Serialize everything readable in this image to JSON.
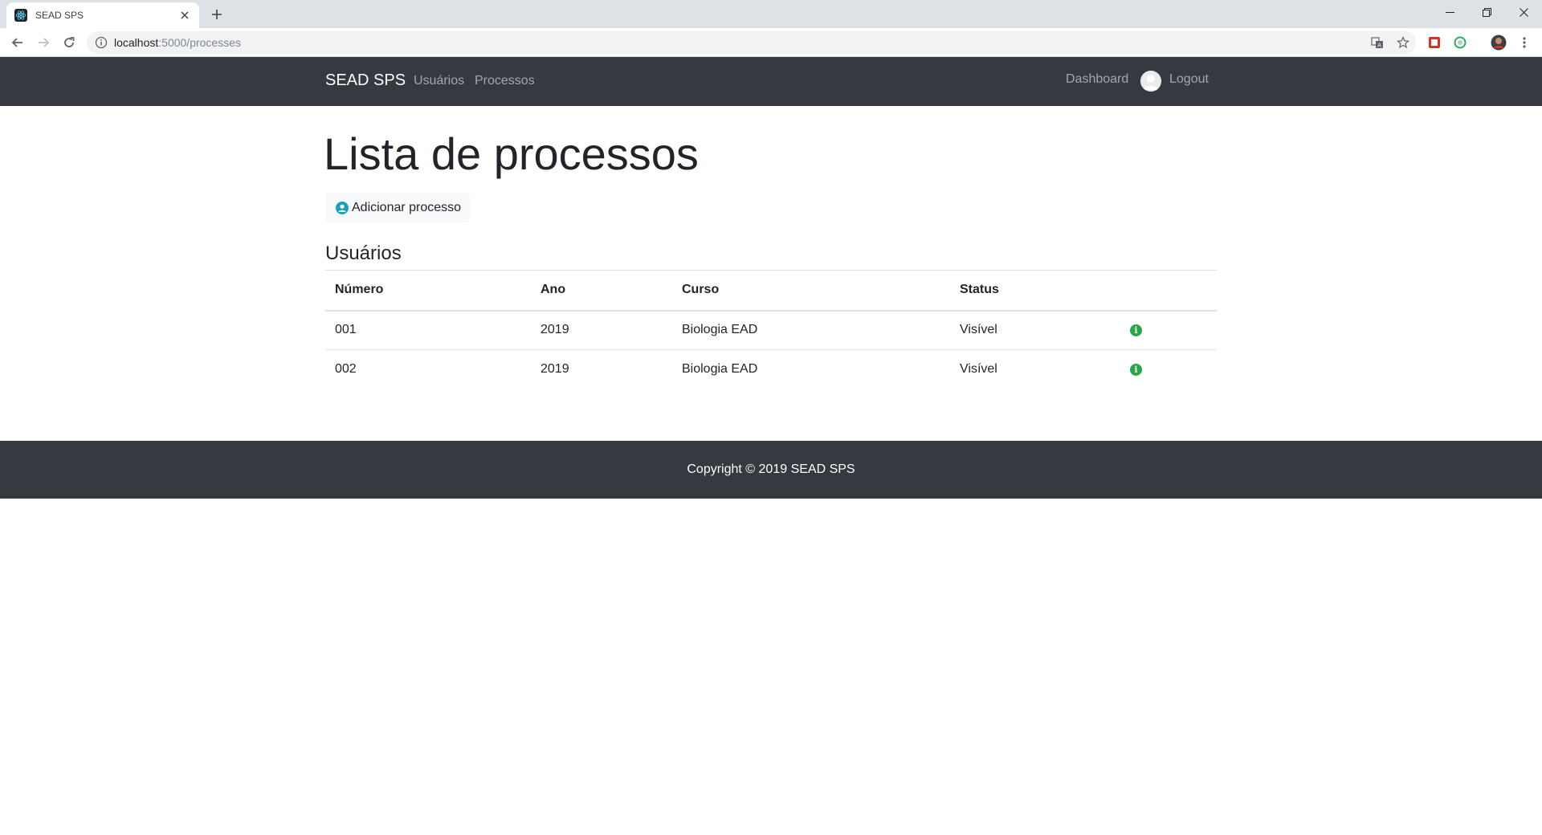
{
  "browser": {
    "tab_title": "SEAD SPS",
    "url_host": "localhost",
    "url_path": ":5000/processes"
  },
  "navbar": {
    "brand": "SEAD SPS",
    "links": [
      "Usuários",
      "Processos"
    ],
    "dashboard": "Dashboard",
    "logout": "Logout"
  },
  "main": {
    "title": "Lista de processos",
    "add_button": "Adicionar processo",
    "section_title": "Usuários",
    "table": {
      "headers": [
        "Número",
        "Ano",
        "Curso",
        "Status"
      ],
      "rows": [
        {
          "numero": "001",
          "ano": "2019",
          "curso": "Biologia EAD",
          "status": "Visível"
        },
        {
          "numero": "002",
          "ano": "2019",
          "curso": "Biologia EAD",
          "status": "Visível"
        }
      ]
    }
  },
  "footer": {
    "text": "Copyright © 2019 SEAD SPS"
  },
  "colors": {
    "navbar_bg": "#343a40",
    "info_green": "#28a745",
    "user_icon_blue": "#17a2b8"
  }
}
